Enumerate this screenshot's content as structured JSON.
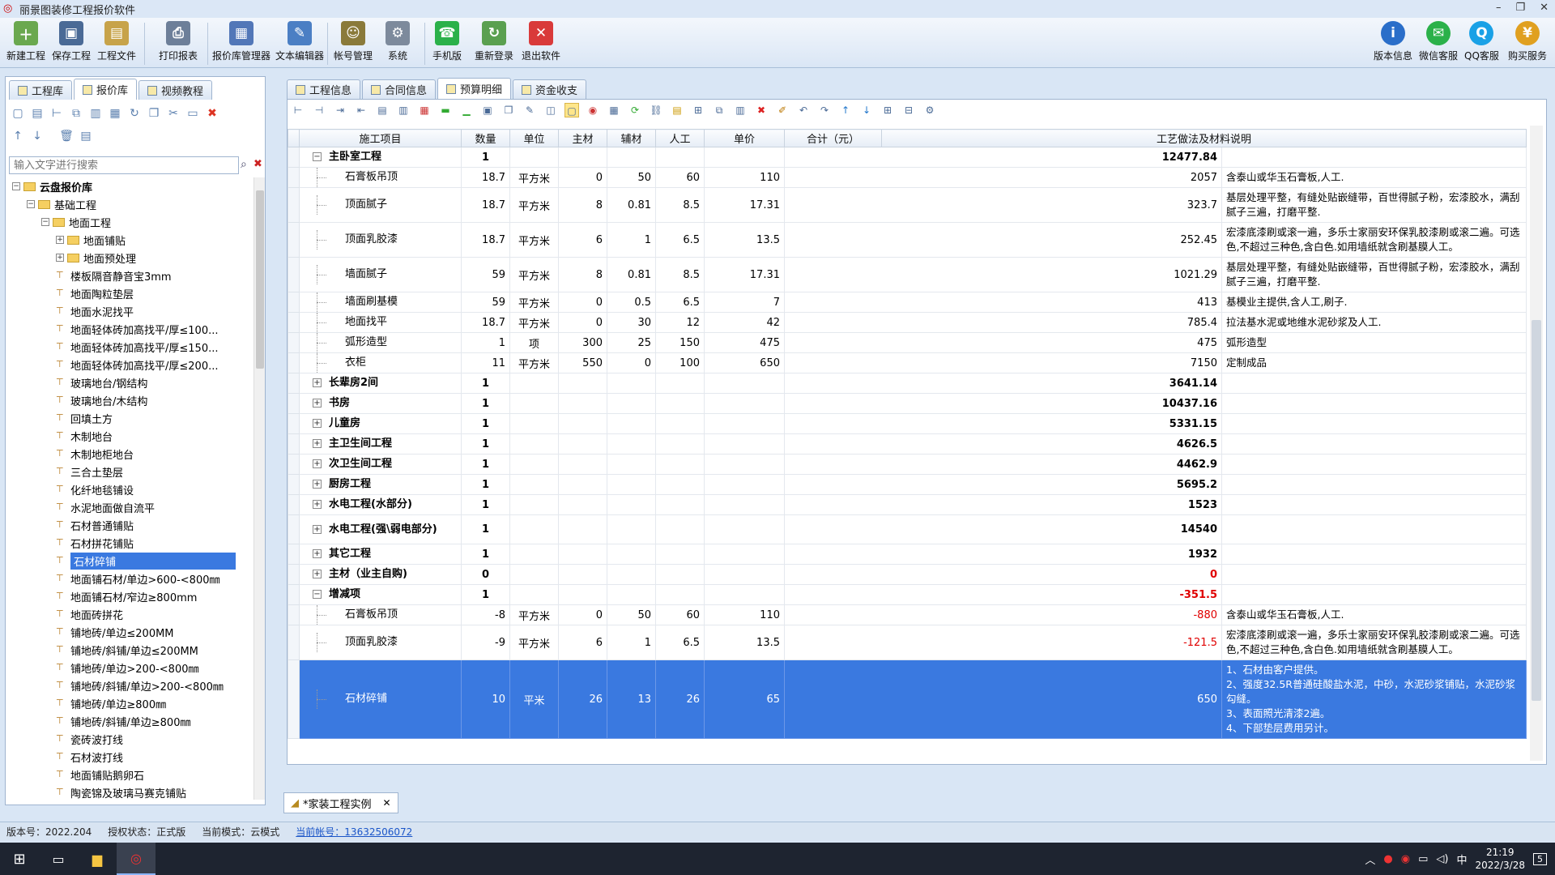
{
  "app": {
    "title": "丽景图装修工程报价软件",
    "minimize": "–",
    "restore": "❐",
    "close": "✕"
  },
  "toolbar": [
    {
      "label": "新建工程",
      "icon": "new-project-icon",
      "color": "#6aa84f",
      "glyph": "＋"
    },
    {
      "label": "保存工程",
      "icon": "save-icon",
      "color": "#4a6a96",
      "glyph": "▣"
    },
    {
      "label": "工程文件",
      "icon": "project-file-icon",
      "color": "#c7a34a",
      "glyph": "▤"
    },
    {
      "label": "打印报表",
      "icon": "print-icon",
      "color": "#6d7f99",
      "glyph": "⎙"
    },
    {
      "label": "报价库管理器",
      "icon": "library-manager-icon",
      "color": "#5277b8",
      "glyph": "▦"
    },
    {
      "label": "文本编辑器",
      "icon": "text-editor-icon",
      "color": "#4b7fc4",
      "glyph": "✎"
    },
    {
      "label": "帐号管理",
      "icon": "account-icon",
      "color": "#8a7a3a",
      "glyph": "☺"
    },
    {
      "label": "系统",
      "icon": "system-gear-icon",
      "color": "#7d8a9c",
      "glyph": "⚙"
    },
    {
      "label": "手机版",
      "icon": "mobile-icon",
      "color": "#2bb14a",
      "glyph": "☎"
    },
    {
      "label": "重新登录",
      "icon": "relogin-icon",
      "color": "#5aa050",
      "glyph": "↻"
    },
    {
      "label": "退出软件",
      "icon": "exit-icon",
      "color": "#d93a3a",
      "glyph": "✕"
    }
  ],
  "toolbar_right": [
    {
      "label": "版本信息",
      "icon": "info-icon",
      "color": "#2a6ec9",
      "glyph": "i"
    },
    {
      "label": "微信客服",
      "icon": "wechat-icon",
      "color": "#2bb14a",
      "glyph": "✉"
    },
    {
      "label": "QQ客服",
      "icon": "qq-icon",
      "color": "#1aa1e6",
      "glyph": "Q"
    },
    {
      "label": "购买服务",
      "icon": "purchase-icon",
      "color": "#e0a020",
      "glyph": "¥"
    }
  ],
  "left": {
    "tabs": [
      "工程库",
      "报价库",
      "视频教程"
    ],
    "active_tab": 1,
    "search_placeholder": "输入文字进行搜索",
    "tree": [
      {
        "label": "云盘报价库",
        "level": 0,
        "type": "root",
        "bold": true
      },
      {
        "label": "基础工程",
        "level": 1,
        "type": "folder"
      },
      {
        "label": "地面工程",
        "level": 2,
        "type": "folder"
      },
      {
        "label": "地面铺贴",
        "level": 3,
        "type": "folder"
      },
      {
        "label": "地面预处理",
        "level": 3,
        "type": "folder"
      },
      {
        "label": "楼板隔音静音宝3mm",
        "level": 3,
        "type": "leaf"
      },
      {
        "label": "地面陶粒垫层",
        "level": 3,
        "type": "leaf"
      },
      {
        "label": "地面水泥找平",
        "level": 3,
        "type": "leaf"
      },
      {
        "label": "地面轻体砖加高找平/厚≤100...",
        "level": 3,
        "type": "leaf"
      },
      {
        "label": "地面轻体砖加高找平/厚≤150...",
        "level": 3,
        "type": "leaf"
      },
      {
        "label": "地面轻体砖加高找平/厚≤200...",
        "level": 3,
        "type": "leaf"
      },
      {
        "label": "玻璃地台/钢结构",
        "level": 3,
        "type": "leaf"
      },
      {
        "label": "玻璃地台/木结构",
        "level": 3,
        "type": "leaf"
      },
      {
        "label": "回填土方",
        "level": 3,
        "type": "leaf"
      },
      {
        "label": "木制地台",
        "level": 3,
        "type": "leaf"
      },
      {
        "label": "木制地柜地台",
        "level": 3,
        "type": "leaf"
      },
      {
        "label": "三合土垫层",
        "level": 3,
        "type": "leaf"
      },
      {
        "label": "化纤地毯铺设",
        "level": 3,
        "type": "leaf"
      },
      {
        "label": "水泥地面做自流平",
        "level": 3,
        "type": "leaf"
      },
      {
        "label": "石材普通铺贴",
        "level": 3,
        "type": "leaf"
      },
      {
        "label": "石材拼花铺贴",
        "level": 3,
        "type": "leaf"
      },
      {
        "label": "石材碎铺",
        "level": 3,
        "type": "leaf",
        "selected": true
      },
      {
        "label": "地面铺石材/单边>600-<800㎜",
        "level": 3,
        "type": "leaf"
      },
      {
        "label": "地面铺石材/窄边≥800mm",
        "level": 3,
        "type": "leaf"
      },
      {
        "label": "地面砖拼花",
        "level": 3,
        "type": "leaf"
      },
      {
        "label": "铺地砖/单边≤200MM",
        "level": 3,
        "type": "leaf"
      },
      {
        "label": "铺地砖/斜铺/单边≤200MM",
        "level": 3,
        "type": "leaf"
      },
      {
        "label": "铺地砖/单边>200-<800㎜",
        "level": 3,
        "type": "leaf"
      },
      {
        "label": "铺地砖/斜铺/单边>200-<800㎜",
        "level": 3,
        "type": "leaf"
      },
      {
        "label": "铺地砖/单边≥800㎜",
        "level": 3,
        "type": "leaf"
      },
      {
        "label": "铺地砖/斜铺/单边≥800㎜",
        "level": 3,
        "type": "leaf"
      },
      {
        "label": "瓷砖波打线",
        "level": 3,
        "type": "leaf"
      },
      {
        "label": "石材波打线",
        "level": 3,
        "type": "leaf"
      },
      {
        "label": "地面铺贴鹅卵石",
        "level": 3,
        "type": "leaf"
      },
      {
        "label": "陶瓷锦及玻璃马赛克铺贴",
        "level": 3,
        "type": "leaf"
      }
    ]
  },
  "main": {
    "tabs": [
      "工程信息",
      "合同信息",
      "预算明细",
      "资金收支"
    ],
    "active_tab": 2,
    "columns": [
      "施工项目",
      "数量",
      "单位",
      "主材",
      "辅材",
      "人工",
      "单价",
      "合计（元）",
      "工艺做法及材料说明"
    ],
    "rows": [
      {
        "kind": "group",
        "expand": "-",
        "name": "主卧室工程",
        "qty": "1",
        "total": "12477.84"
      },
      {
        "kind": "item",
        "name": "石膏板吊顶",
        "qty": "18.7",
        "unit": "平方米",
        "main": "0",
        "aux": "50",
        "labor": "60",
        "price": "110",
        "total": "2057",
        "desc": "含泰山或华玉石膏板,人工."
      },
      {
        "kind": "item",
        "tall": true,
        "name": "顶面腻子",
        "qty": "18.7",
        "unit": "平方米",
        "main": "8",
        "aux": "0.81",
        "labor": "8.5",
        "price": "17.31",
        "total": "323.7",
        "desc": "基层处理平整，有缝处贴嵌缝带，百世得腻子粉，宏漆胶水，满刮腻子三遍，打磨平整."
      },
      {
        "kind": "item",
        "tall": true,
        "name": "顶面乳胶漆",
        "qty": "18.7",
        "unit": "平方米",
        "main": "6",
        "aux": "1",
        "labor": "6.5",
        "price": "13.5",
        "total": "252.45",
        "desc": "宏漆底漆刷或滚一遍，多乐士家丽安环保乳胶漆刷或滚二遍。可选色,不超过三种色,含白色.如用墙纸就含刷基膜人工。"
      },
      {
        "kind": "item",
        "tall": true,
        "name": "墙面腻子",
        "qty": "59",
        "unit": "平方米",
        "main": "8",
        "aux": "0.81",
        "labor": "8.5",
        "price": "17.31",
        "total": "1021.29",
        "desc": "基层处理平整，有缝处贴嵌缝带，百世得腻子粉，宏漆胶水，满刮腻子三遍，打磨平整."
      },
      {
        "kind": "item",
        "name": "墙面刷基模",
        "qty": "59",
        "unit": "平方米",
        "main": "0",
        "aux": "0.5",
        "labor": "6.5",
        "price": "7",
        "total": "413",
        "desc": "基模业主提供,含人工,刷子."
      },
      {
        "kind": "item",
        "name": "地面找平",
        "qty": "18.7",
        "unit": "平方米",
        "main": "0",
        "aux": "30",
        "labor": "12",
        "price": "42",
        "total": "785.4",
        "desc": "拉法基水泥或地维水泥砂浆及人工."
      },
      {
        "kind": "item",
        "name": "弧形造型",
        "qty": "1",
        "unit": "项",
        "main": "300",
        "aux": "25",
        "labor": "150",
        "price": "475",
        "total": "475",
        "desc": "弧形造型"
      },
      {
        "kind": "item",
        "name": "衣柜",
        "qty": "11",
        "unit": "平方米",
        "main": "550",
        "aux": "0",
        "labor": "100",
        "price": "650",
        "total": "7150",
        "desc": "定制成品"
      },
      {
        "kind": "group",
        "expand": "+",
        "name": "长辈房2间",
        "qty": "1",
        "total": "3641.14"
      },
      {
        "kind": "group",
        "expand": "+",
        "name": "书房",
        "qty": "1",
        "total": "10437.16"
      },
      {
        "kind": "group",
        "expand": "+",
        "name": "儿童房",
        "qty": "1",
        "total": "5331.15"
      },
      {
        "kind": "group",
        "expand": "+",
        "name": "主卫生间工程",
        "qty": "1",
        "total": "4626.5"
      },
      {
        "kind": "group",
        "expand": "+",
        "name": "次卫生间工程",
        "qty": "1",
        "total": "4462.9"
      },
      {
        "kind": "group",
        "expand": "+",
        "name": "厨房工程",
        "qty": "1",
        "total": "5695.2"
      },
      {
        "kind": "group",
        "expand": "+",
        "name": "水电工程(水部分)",
        "qty": "1",
        "total": "1523"
      },
      {
        "kind": "group",
        "expand": "+",
        "tall": true,
        "name": "水电工程(强\\弱电部分)",
        "qty": "1",
        "total": "14540"
      },
      {
        "kind": "group",
        "expand": "+",
        "name": "其它工程",
        "qty": "1",
        "total": "1932"
      },
      {
        "kind": "group",
        "expand": "+",
        "name": "主材（业主自购)",
        "qty": "0",
        "total": "0",
        "red": true
      },
      {
        "kind": "group",
        "expand": "-",
        "name": "增减项",
        "qty": "1",
        "total": "-351.5",
        "red": true
      },
      {
        "kind": "item",
        "name": "石膏板吊顶",
        "qty": "-8",
        "unit": "平方米",
        "main": "0",
        "aux": "50",
        "labor": "60",
        "price": "110",
        "total": "-880",
        "red": true,
        "desc": "含泰山或华玉石膏板,人工."
      },
      {
        "kind": "item",
        "tall": true,
        "name": "顶面乳胶漆",
        "qty": "-9",
        "unit": "平方米",
        "main": "6",
        "aux": "1",
        "labor": "6.5",
        "price": "13.5",
        "total": "-121.5",
        "red": true,
        "desc": "宏漆底漆刷或滚一遍，多乐士家丽安环保乳胶漆刷或滚二遍。可选色,不超过三种色,含白色.如用墙纸就含刷基膜人工。"
      },
      {
        "kind": "item",
        "selected": true,
        "xtall": true,
        "name": "石材碎铺",
        "qty": "10",
        "unit": "平米",
        "main": "26",
        "aux": "13",
        "labor": "26",
        "price": "65",
        "total": "650",
        "desc": "1、石材由客户提供。\n2、强度32.5R普通硅酸盐水泥，中砂，水泥砂浆铺贴，水泥砂浆勾缝。\n3、表面照光清漆2遍。\n4、下部垫层费用另计。"
      }
    ]
  },
  "doc_tab": "*家装工程实例",
  "status": {
    "version": "版本号：2022.204",
    "license": "授权状态：正式版",
    "mode": "当前模式：云模式",
    "account": "当前帐号：13632506072"
  },
  "taskbar": {
    "time": "21:19",
    "date": "2022/3/28",
    "ime": "中",
    "notify": "5"
  }
}
